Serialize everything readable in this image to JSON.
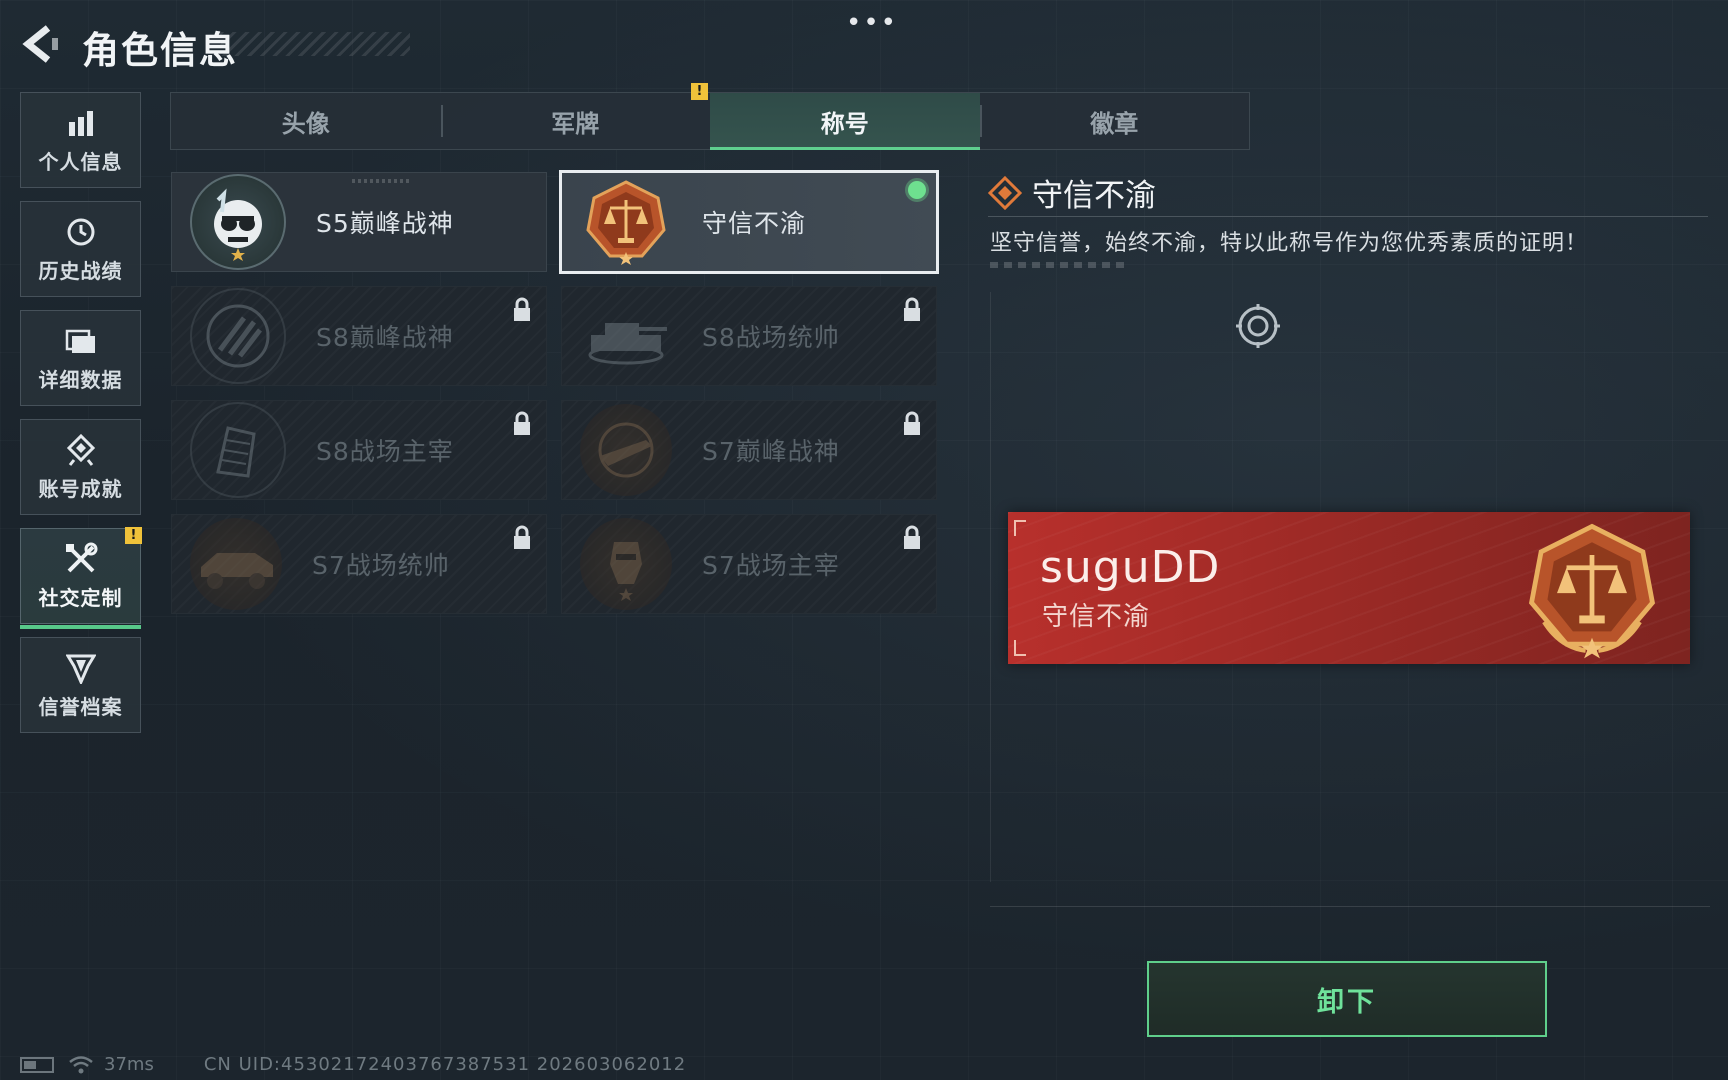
{
  "header": {
    "title": "角色信息",
    "more_label": "•••"
  },
  "sidebar": {
    "items": [
      {
        "label": "个人信息",
        "icon": "bar-chart-icon"
      },
      {
        "label": "历史战绩",
        "icon": "history-icon"
      },
      {
        "label": "详细数据",
        "icon": "folder-icon"
      },
      {
        "label": "账号成就",
        "icon": "achievement-icon"
      },
      {
        "label": "社交定制",
        "icon": "tools-icon",
        "active": true
      },
      {
        "label": "信誉档案",
        "icon": "credit-shield-icon"
      }
    ],
    "warn_badge": "!"
  },
  "tabs": [
    {
      "label": "头像"
    },
    {
      "label": "军牌"
    },
    {
      "label": "称号",
      "active": true
    },
    {
      "label": "徽章"
    }
  ],
  "tab_warn_badge": "!",
  "titles": [
    {
      "name": "S5巅峰战神",
      "locked": false,
      "selected": false,
      "emblem": "diver-skull-emblem"
    },
    {
      "name": "守信不渝",
      "locked": false,
      "selected": true,
      "emblem": "scales-emblem"
    },
    {
      "name": "S8巅峰战神",
      "locked": true,
      "emblem": "stripes-emblem"
    },
    {
      "name": "S8战场统帅",
      "locked": true,
      "emblem": "tank-emblem"
    },
    {
      "name": "S8战场主宰",
      "locked": true,
      "emblem": "building-emblem"
    },
    {
      "name": "S7巅峰战神",
      "locked": true,
      "emblem": "weapon-emblem"
    },
    {
      "name": "S7战场统帅",
      "locked": true,
      "emblem": "vehicle-emblem"
    },
    {
      "name": "S7战场主宰",
      "locked": true,
      "emblem": "soldier-emblem"
    }
  ],
  "detail": {
    "title": "守信不渝",
    "description": "坚守信誉，始终不渝，特以此称号作为您优秀素质的证明！",
    "banner": {
      "player_name": "suguDD",
      "title": "守信不渝"
    },
    "action_button": "卸下"
  },
  "status": {
    "ping": "37ms",
    "uid": "CN UID:45302172403767387531 202603062012"
  },
  "colors": {
    "accent_green": "#5fd08f",
    "banner_red": "#b8302c",
    "warning_yellow": "#f0c23a",
    "emblem_orange": "#c8602e"
  }
}
